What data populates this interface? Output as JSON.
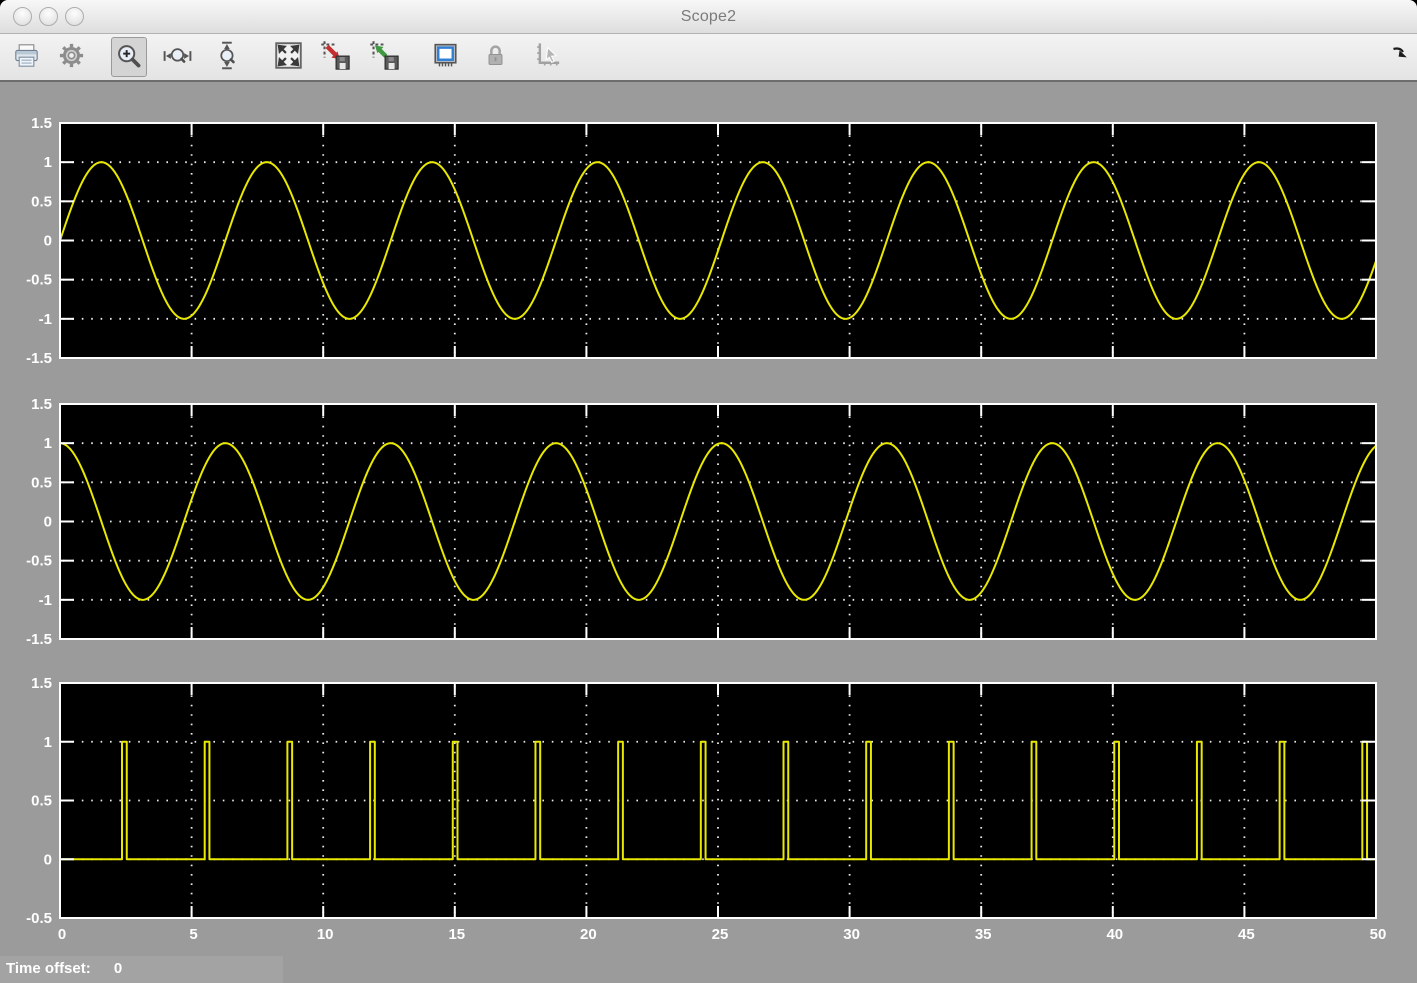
{
  "window": {
    "title": "Scope2",
    "traffic_lights": [
      "close",
      "minimize",
      "zoom"
    ]
  },
  "toolbar": {
    "buttons": [
      {
        "name": "print",
        "icon": "printer-icon",
        "selected": false,
        "disabled": false
      },
      {
        "name": "parameters",
        "icon": "gear-icon",
        "selected": false,
        "disabled": false
      },
      {
        "name": "zoom",
        "icon": "zoom-icon",
        "selected": true,
        "disabled": false
      },
      {
        "name": "zoom-x",
        "icon": "zoom-x-icon",
        "selected": false,
        "disabled": false
      },
      {
        "name": "zoom-y",
        "icon": "zoom-y-icon",
        "selected": false,
        "disabled": false
      },
      {
        "name": "autoscale",
        "icon": "autoscale-icon",
        "selected": false,
        "disabled": false
      },
      {
        "name": "save-axes",
        "icon": "save-axes-icon",
        "selected": false,
        "disabled": false
      },
      {
        "name": "restore-axes",
        "icon": "restore-axes-icon",
        "selected": false,
        "disabled": false
      },
      {
        "name": "floating-scope",
        "icon": "floating-scope-icon",
        "selected": false,
        "disabled": false
      },
      {
        "name": "lock-axes",
        "icon": "lock-icon",
        "selected": false,
        "disabled": true
      },
      {
        "name": "signal-selection",
        "icon": "signal-selection-icon",
        "selected": false,
        "disabled": true
      }
    ],
    "dock_button": {
      "name": "dock",
      "icon": "dock-arrow-icon"
    }
  },
  "status_bar": {
    "time_offset_label": "Time offset:",
    "time_offset_value": "0"
  },
  "colors": {
    "window_background": "#9b9b9b",
    "plot_background": "#000000",
    "trace": "#e8e800",
    "grid": "#ffffff",
    "axis_frame": "#ffffff",
    "tick_label": "#ffffff",
    "title_text": "#7b7b7b"
  },
  "chart_data": [
    {
      "type": "line",
      "title": "",
      "signal": {
        "kind": "sine",
        "expression": "sin(t)",
        "amplitude": 1,
        "angular_frequency_rad_per_s": 1,
        "phase_rad": 0
      },
      "x_range": [
        0,
        50
      ],
      "y_range": [
        -1.5,
        1.5
      ],
      "x_ticks": [
        0,
        5,
        10,
        15,
        20,
        25,
        30,
        35,
        40,
        45,
        50
      ],
      "y_ticks": [
        -1.5,
        -1,
        -0.5,
        0,
        0.5,
        1,
        1.5
      ],
      "x_tick_labels_visible": false,
      "grid": true,
      "legend": null
    },
    {
      "type": "line",
      "title": "",
      "signal": {
        "kind": "sine",
        "expression": "cos(t)",
        "amplitude": 1,
        "angular_frequency_rad_per_s": 1,
        "phase_rad": 1.5707963
      },
      "x_range": [
        0,
        50
      ],
      "y_range": [
        -1.5,
        1.5
      ],
      "x_ticks": [
        0,
        5,
        10,
        15,
        20,
        25,
        30,
        35,
        40,
        45,
        50
      ],
      "y_ticks": [
        -1.5,
        -1,
        -0.5,
        0,
        0.5,
        1,
        1.5
      ],
      "x_tick_labels_visible": false,
      "grid": true,
      "legend": null
    },
    {
      "type": "line",
      "title": "",
      "signal": {
        "kind": "pulse-train",
        "low": 0,
        "high": 1,
        "pulse_width": 0.18,
        "pulse_times": [
          2.3562,
          5.4978,
          8.6394,
          11.781,
          14.9226,
          18.0642,
          21.2058,
          24.3473,
          27.4889,
          30.6305,
          33.7721,
          36.9137,
          40.0553,
          43.1969,
          46.3385,
          49.4801
        ]
      },
      "x_range": [
        0,
        50
      ],
      "y_range": [
        -0.5,
        1.5
      ],
      "x_ticks": [
        0,
        5,
        10,
        15,
        20,
        25,
        30,
        35,
        40,
        45,
        50
      ],
      "y_ticks": [
        -0.5,
        0,
        0.5,
        1,
        1.5
      ],
      "x_tick_labels_visible": true,
      "grid": true,
      "legend": null
    }
  ]
}
